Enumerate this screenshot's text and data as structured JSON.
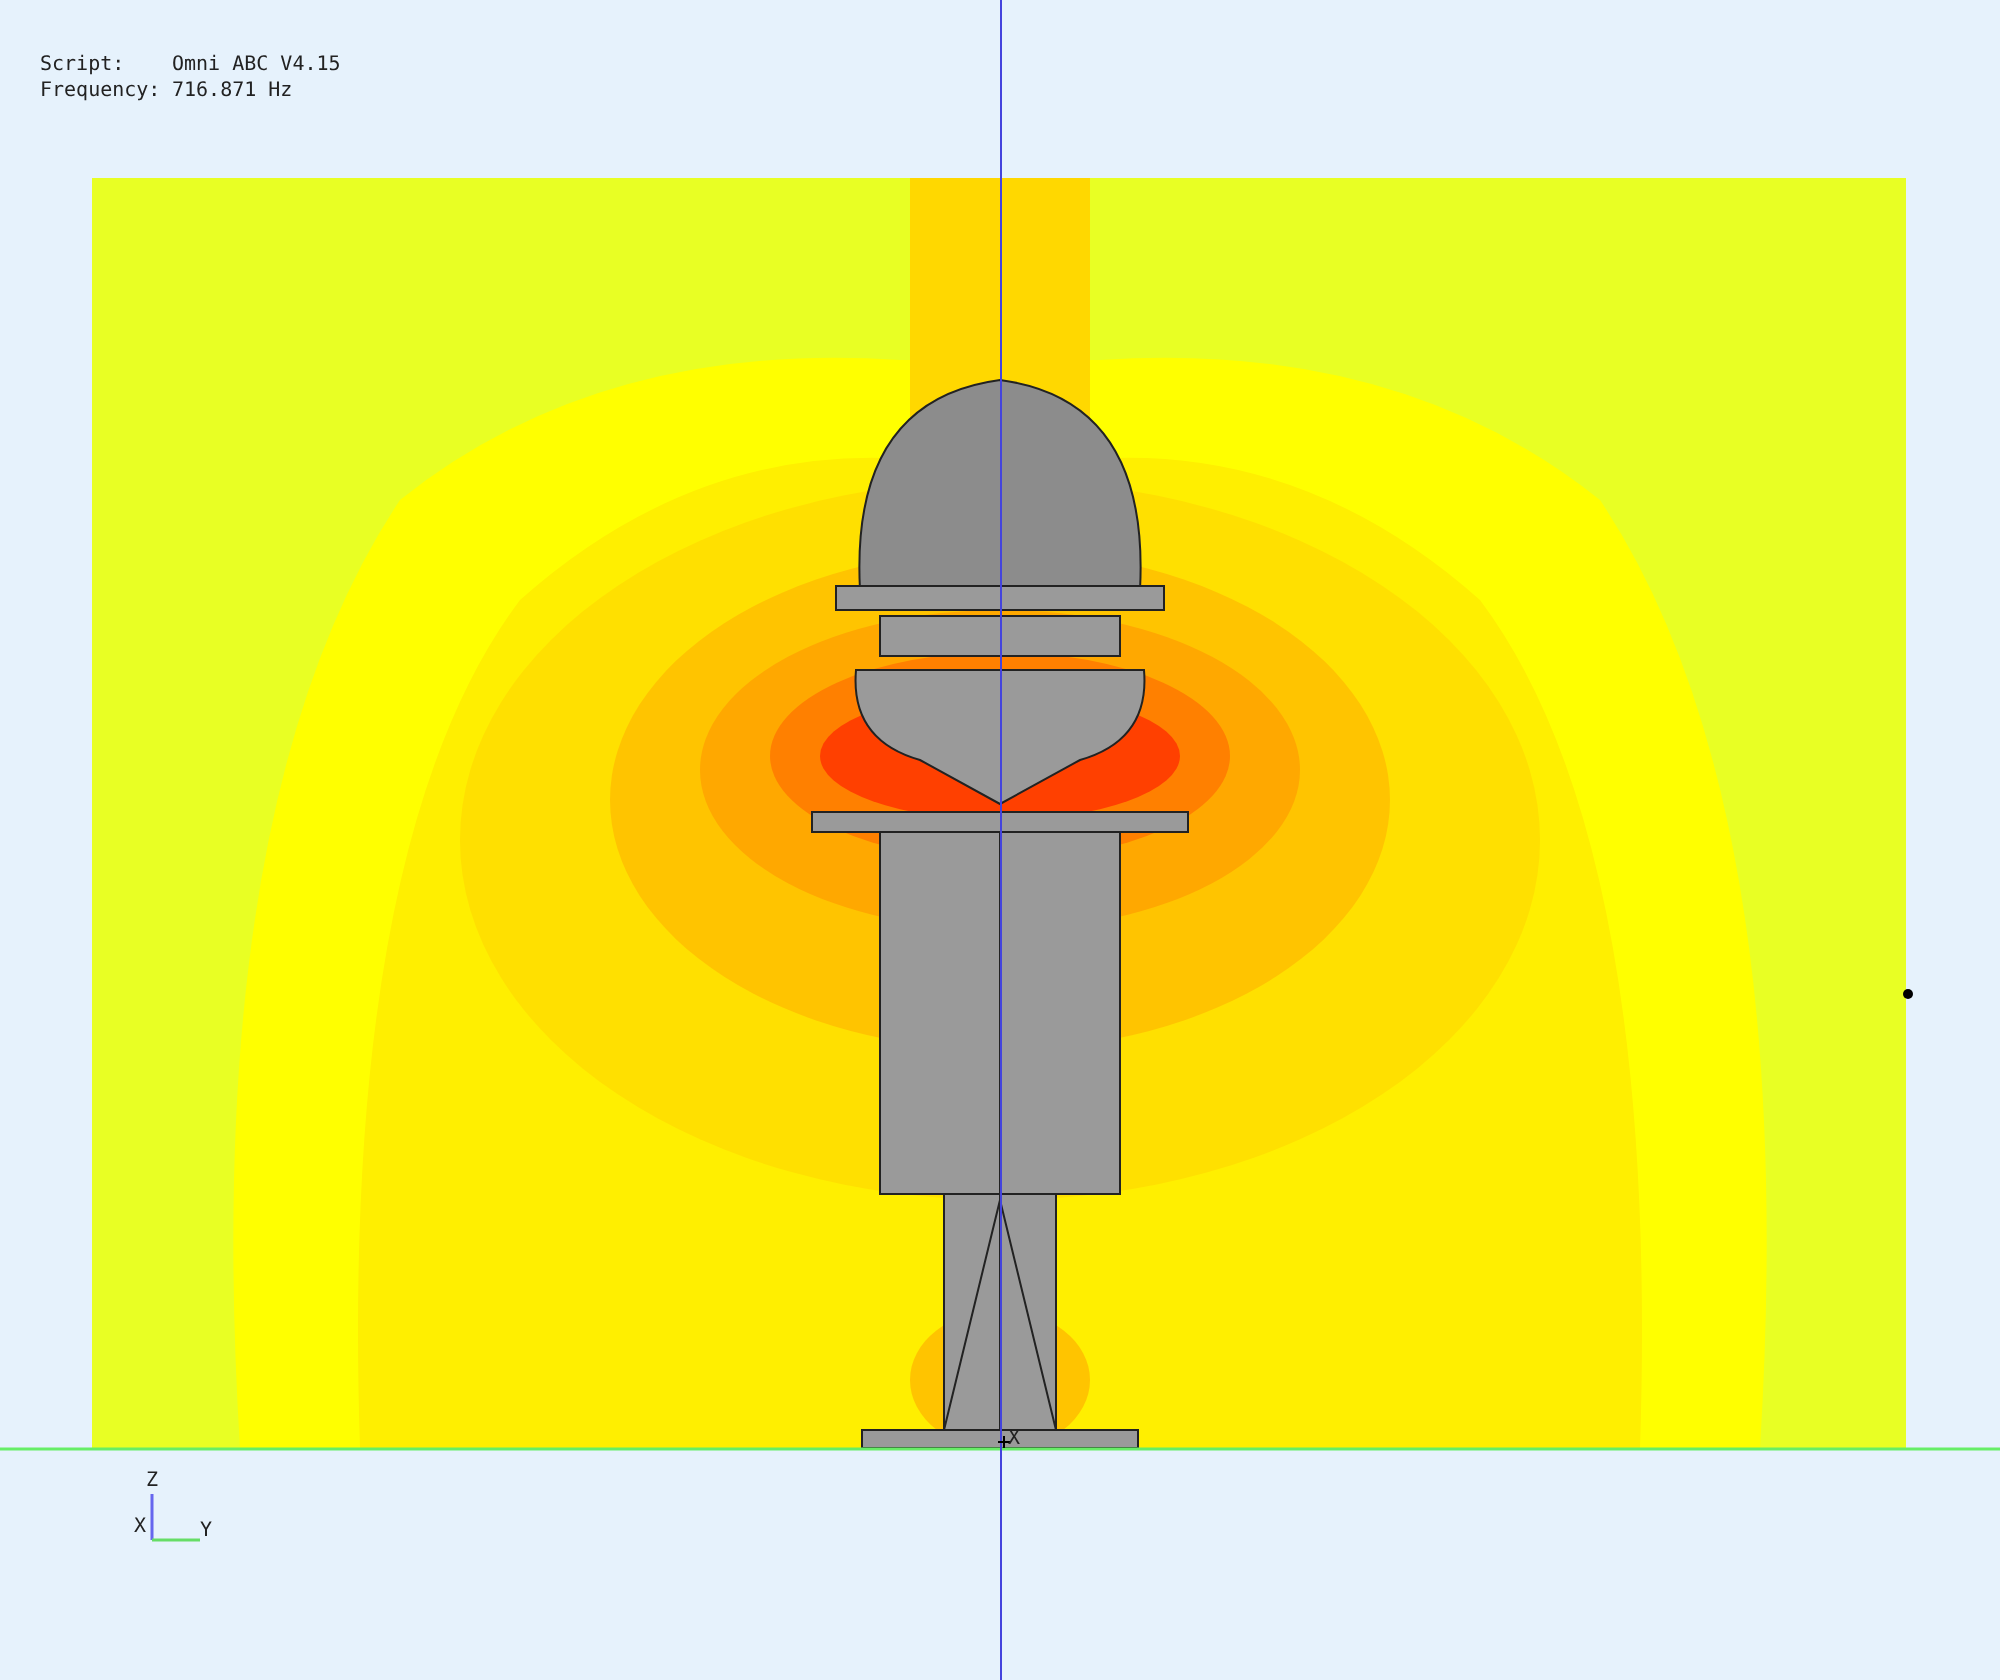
{
  "info": [
    {
      "label": "Script:",
      "value": "Omni ABC V4.15"
    },
    {
      "label": "Frequency:",
      "value": "716.871 Hz"
    }
  ],
  "origin_label": "X",
  "axes": {
    "z": "Z",
    "x": "X",
    "y": "Y"
  }
}
